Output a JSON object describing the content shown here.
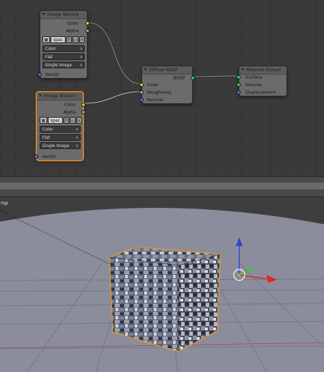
{
  "node_editor": {
    "nodes": {
      "image_texture_1": {
        "title": "Image Texture",
        "out_color": "Color",
        "out_alpha": "Alpha",
        "image_name": "spac",
        "image_f": "F",
        "color_space": "Color",
        "projection": "Flat",
        "source": "Single Image",
        "in_vector": "Vector"
      },
      "image_texture_2": {
        "title": "Image Texture",
        "out_color": "Color",
        "out_alpha": "Alpha",
        "image_name": "spac",
        "image_f": "F",
        "color_space": "Color",
        "projection": "Flat",
        "source": "Single Image",
        "in_vector": "Vector"
      },
      "diffuse_bsdf": {
        "title": "Diffuse BSDF",
        "out_bsdf": "BSDF",
        "in_color": "Color",
        "in_roughness": "Roughness",
        "in_normal": "Normal"
      },
      "material_output": {
        "title": "Material Output",
        "in_surface": "Surface",
        "in_volume": "Volume",
        "in_displacement": "Displacement"
      }
    },
    "colors": {
      "socket_color": "#e6d02f",
      "socket_float": "#a3a3a3",
      "socket_vector": "#6a63d8",
      "socket_shader": "#33d17a",
      "selected_outline": "#d98a2b"
    }
  },
  "viewport": {
    "view_label": "rsp",
    "gizmo_colors": {
      "x": "#d42a2a",
      "y": "#3ec23e",
      "z": "#2a4ad4"
    }
  }
}
